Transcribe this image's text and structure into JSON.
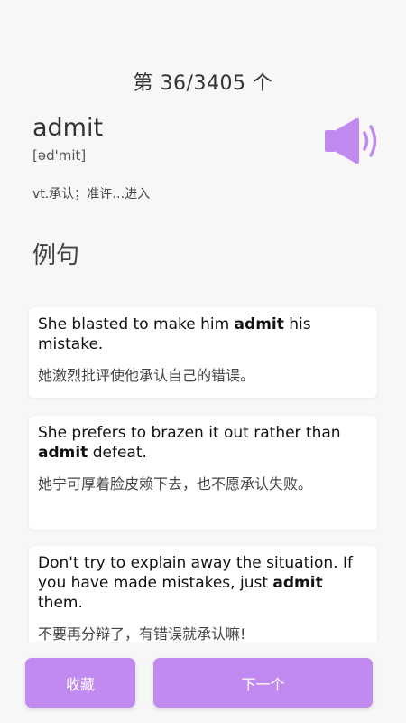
{
  "progress": "第 36/3405 个",
  "word": "admit",
  "phonetic": "[əd'mit]",
  "meaning": "vt.承认；准许…进入",
  "section_title": "例句",
  "icons": {
    "speaker": "speaker-icon"
  },
  "colors": {
    "accent": "#c08af0",
    "background": "#f7f7f8"
  },
  "examples": [
    {
      "en_before": "She blasted to make him ",
      "en_keyword": "admit",
      "en_after": " his mistake.",
      "zh": "她激烈批评使他承认自己的错误。"
    },
    {
      "en_before": "She prefers to brazen it out rather than ",
      "en_keyword": "admit",
      "en_after": " defeat.",
      "zh": "她宁可厚着脸皮赖下去，也不愿承认失败。"
    },
    {
      "en_before": "Don't try to explain away the situation. If you have made mistakes, just ",
      "en_keyword": "admit",
      "en_after": " them.",
      "zh": "不要再分辩了，有错误就承认嘛!"
    }
  ],
  "buttons": {
    "favorite": "收藏",
    "next": "下一个"
  }
}
